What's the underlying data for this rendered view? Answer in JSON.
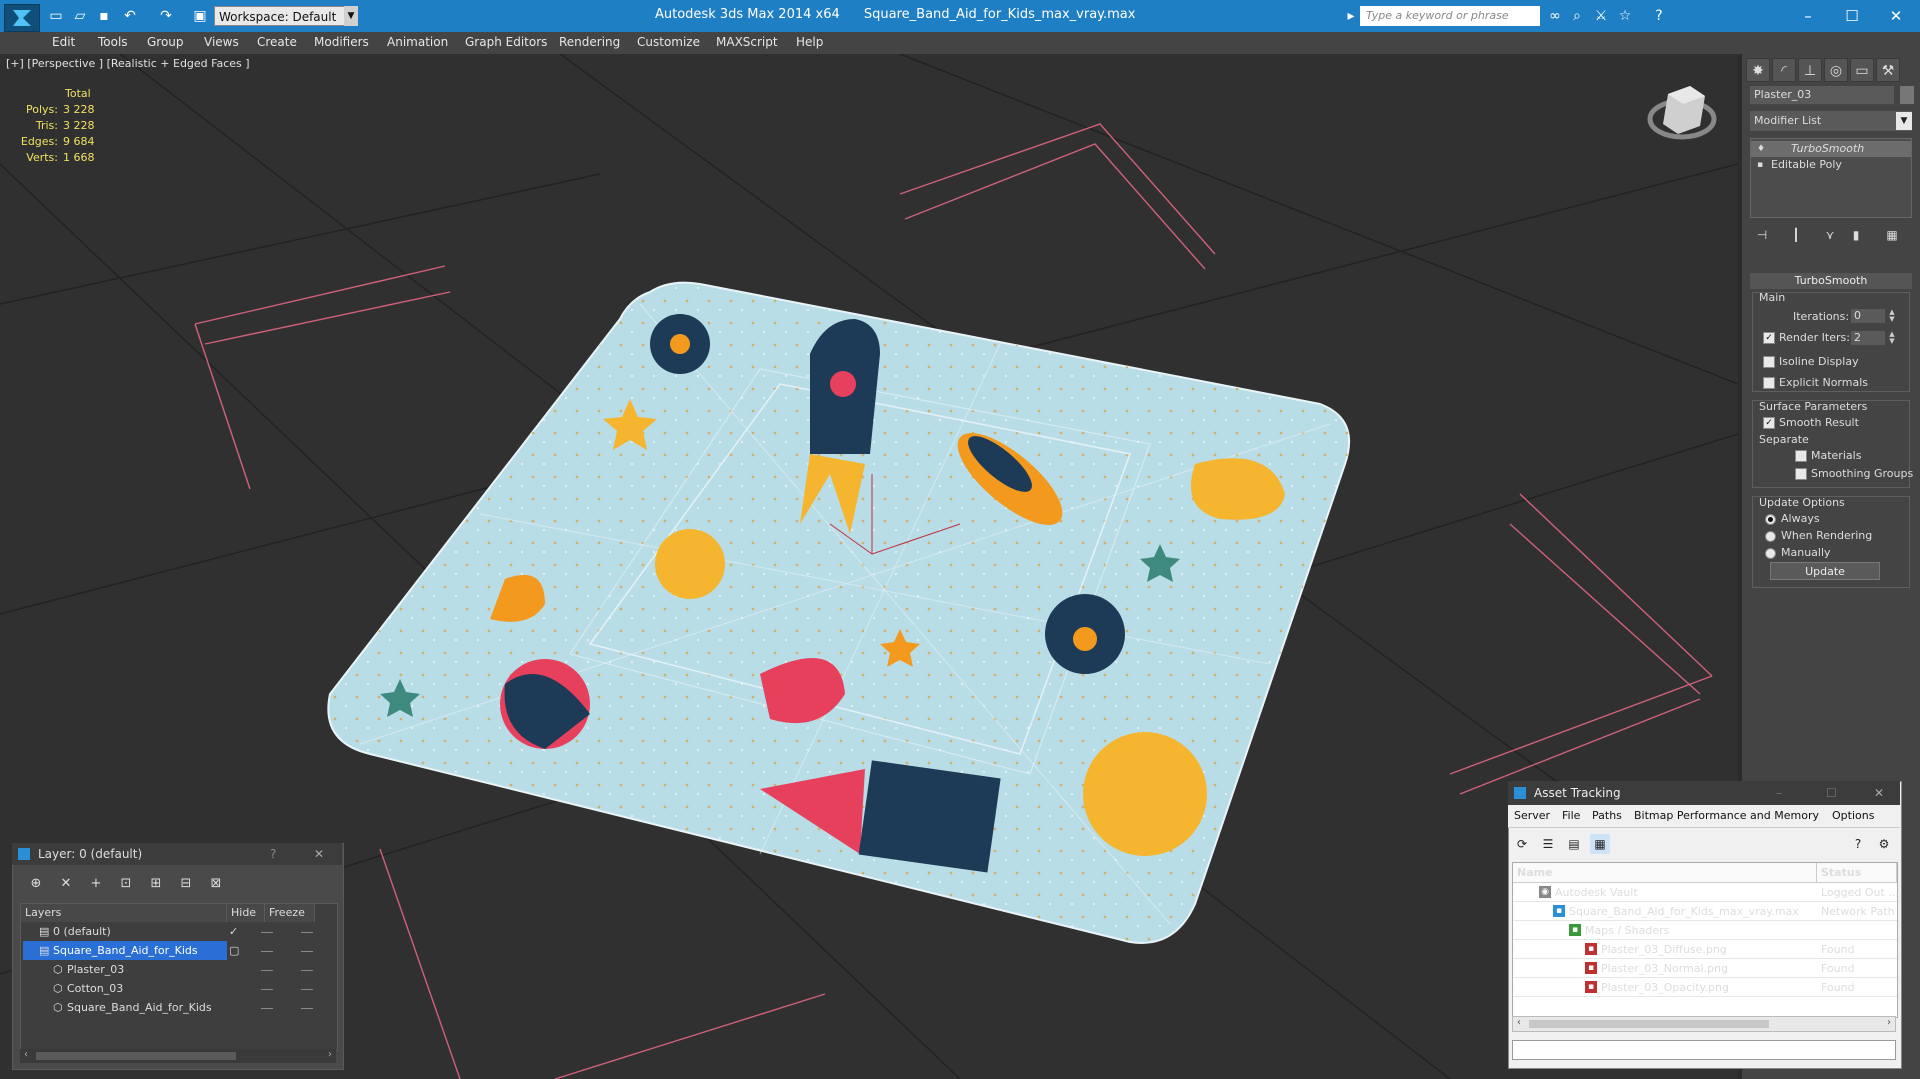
{
  "app": {
    "title_app": "Autodesk 3ds Max  2014 x64",
    "title_file": "Square_Band_Aid_for_Kids_max_vray.max",
    "workspace": "Workspace: Default",
    "search_placeholder": "Type a keyword or phrase"
  },
  "menu": [
    "Edit",
    "Tools",
    "Group",
    "Views",
    "Create",
    "Modifiers",
    "Animation",
    "Graph Editors",
    "Rendering",
    "Customize",
    "MAXScript",
    "Help"
  ],
  "viewport": {
    "label": "[+] [Perspective ] [Realistic + Edged Faces ]",
    "stats_header": "Total",
    "stats": [
      {
        "k": "Polys:",
        "v": "3 228"
      },
      {
        "k": "Tris:",
        "v": "3 228"
      },
      {
        "k": "Edges:",
        "v": "9 684"
      },
      {
        "k": "Verts:",
        "v": "1 668"
      }
    ]
  },
  "command_panel": {
    "object_name": "Plaster_03",
    "modifier_list": "Modifier List",
    "stack": [
      "TurboSmooth",
      "Editable Poly"
    ],
    "rollout": "TurboSmooth",
    "main_label": "Main",
    "iterations_label": "Iterations:",
    "iterations": "0",
    "render_iters_label": "Render Iters:",
    "render_iters": "2",
    "isoline": "Isoline Display",
    "explicit_normals": "Explicit Normals",
    "surface_params": "Surface Parameters",
    "smooth_result": "Smooth Result",
    "separate": "Separate",
    "materials": "Materials",
    "smoothing_groups": "Smoothing Groups",
    "update_options": "Update Options",
    "always": "Always",
    "when_rendering": "When Rendering",
    "manually": "Manually",
    "update_btn": "Update"
  },
  "layer_panel": {
    "title": "Layer: 0 (default)",
    "help": "?",
    "col_layers": "Layers",
    "col_hide": "Hide",
    "col_freeze": "Freeze",
    "rows": [
      {
        "name": "0 (default)"
      },
      {
        "name": "Square_Band_Aid_for_Kids"
      },
      {
        "name": "Plaster_03"
      },
      {
        "name": "Cotton_03"
      },
      {
        "name": "Square_Band_Aid_for_Kids"
      }
    ]
  },
  "asset_panel": {
    "title": "Asset Tracking",
    "menu": [
      "Server",
      "File",
      "Paths",
      "Bitmap Performance and Memory",
      "Options"
    ],
    "col_name": "Name",
    "col_status": "Status",
    "rows": [
      {
        "name": "Autodesk Vault",
        "status": "Logged Out ..."
      },
      {
        "name": "Square_Band_Aid_for_Kids_max_vray.max",
        "status": "Network Path"
      },
      {
        "name": "Maps / Shaders",
        "status": ""
      },
      {
        "name": "Plaster_03_Diffuse.png",
        "status": "Found"
      },
      {
        "name": "Plaster_03_Normal.png",
        "status": "Found"
      },
      {
        "name": "Plaster_03_Opacity.png",
        "status": "Found"
      }
    ]
  },
  "colors": {
    "titlebar": "#1f7fc4",
    "stats": "#f0e060",
    "selection": "#2a6fd6",
    "bandaid": "#b9dde6"
  }
}
